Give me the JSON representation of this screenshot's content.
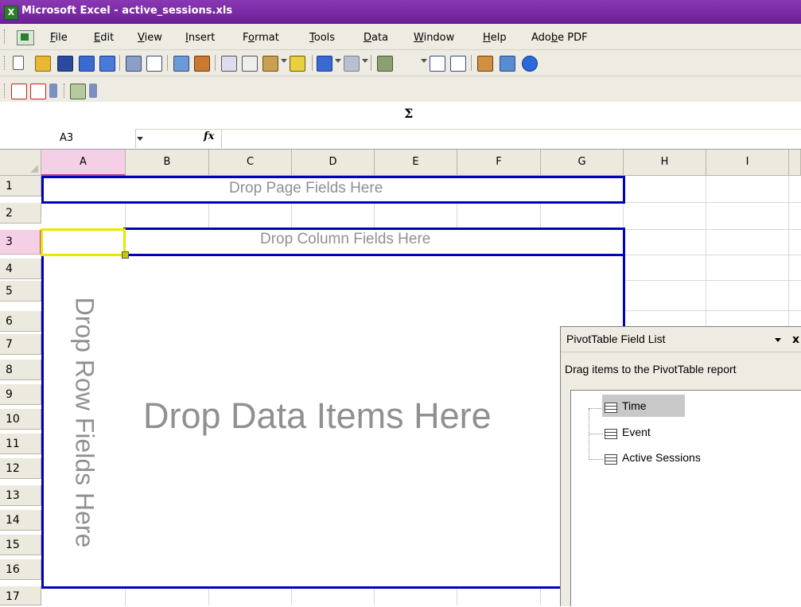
{
  "window": {
    "title": "Microsoft Excel - active_sessions.xls"
  },
  "menu": [
    {
      "label": "File",
      "key": "F"
    },
    {
      "label": "Edit",
      "key": "E"
    },
    {
      "label": "View",
      "key": "V"
    },
    {
      "label": "Insert",
      "key": "I"
    },
    {
      "label": "Format",
      "key": "o"
    },
    {
      "label": "Tools",
      "key": "T"
    },
    {
      "label": "Data",
      "key": "D"
    },
    {
      "label": "Window",
      "key": "W"
    },
    {
      "label": "Help",
      "key": "H"
    },
    {
      "label": "Adobe PDF",
      "key": "b"
    }
  ],
  "toolbar_icons": [
    "new-icon",
    "open-icon",
    "save-icon",
    "permission-icon",
    "print-preview-icon",
    "print-icon",
    "preview-icon",
    "spelling-icon",
    "research-icon",
    "cut-icon",
    "copy-icon",
    "paste-icon",
    "format-painter-icon",
    "undo-icon",
    "redo-icon",
    "hyperlink-icon",
    "autosum-icon",
    "sort-ascending-icon",
    "sort-descending-icon",
    "chart-wizard-icon",
    "drawing-icon",
    "help-icon"
  ],
  "toolbar_text": {
    "sigma": "Σ"
  },
  "formula_bar": {
    "name_box": "A3",
    "fx": "fx",
    "value": ""
  },
  "columns": [
    "A",
    "B",
    "C",
    "D",
    "E",
    "F",
    "G",
    "H",
    "I"
  ],
  "rows": [
    "1",
    "2",
    "3",
    "4",
    "5",
    "6",
    "7",
    "8",
    "9",
    "10",
    "11",
    "12",
    "13",
    "14",
    "15",
    "16",
    "17"
  ],
  "selected_cell": {
    "column": "A",
    "row": "3"
  },
  "pivot": {
    "page_fields": "Drop Page Fields Here",
    "column_fields": "Drop Column Fields Here",
    "row_fields": "Drop Row Fields Here",
    "data_items": "Drop Data Items Here"
  },
  "field_list": {
    "title": "PivotTable Field List",
    "close": "x",
    "instruction": "Drag items to the PivotTable report",
    "fields": [
      {
        "label": "Time",
        "selected": true
      },
      {
        "label": "Event",
        "selected": false
      },
      {
        "label": "Active Sessions",
        "selected": false
      }
    ]
  },
  "colors": {
    "title_bar": "#7a2aa4",
    "pivot_border": "#0000b8",
    "header_selected": "#f5cfe6",
    "active_cell_border": "#e8e800"
  }
}
